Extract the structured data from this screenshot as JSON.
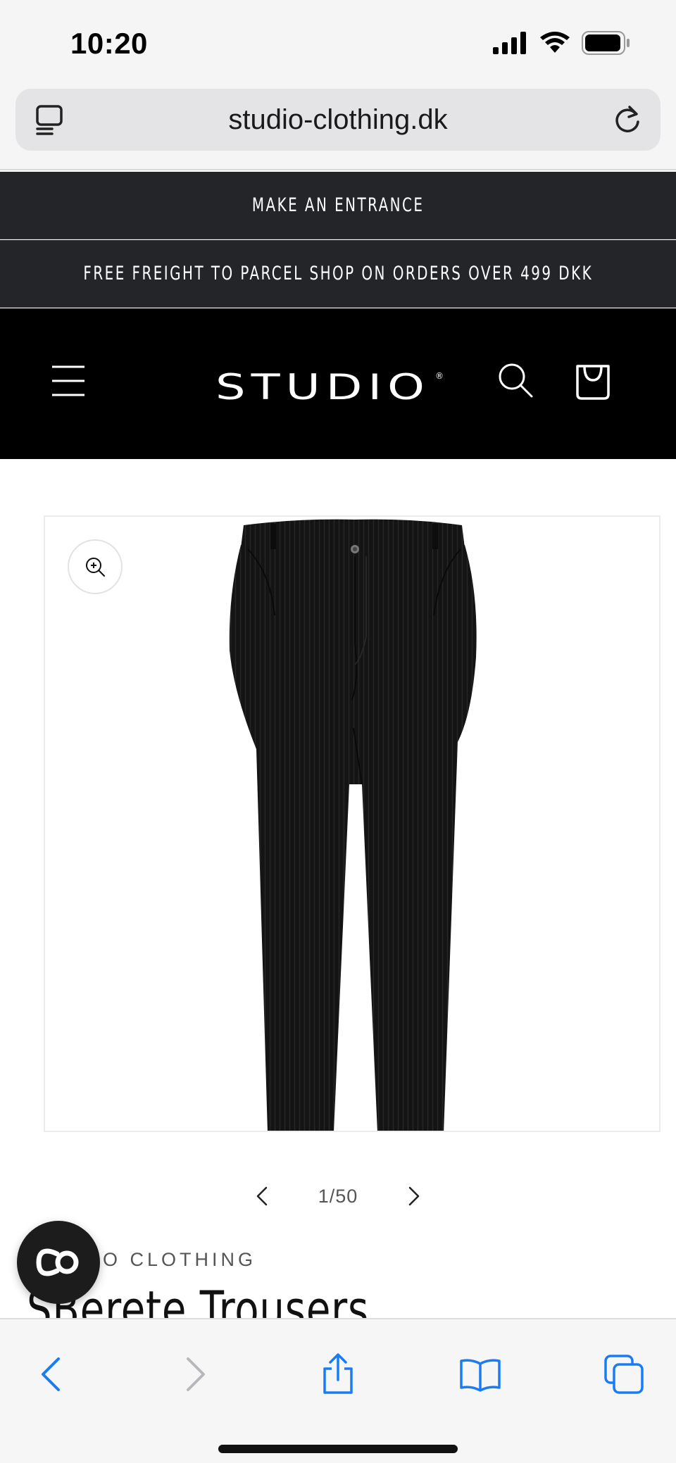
{
  "status_bar": {
    "time": "10:20",
    "icons": [
      "cellular-signal-icon",
      "wifi-icon",
      "battery-icon"
    ]
  },
  "browser": {
    "url": "studio-clothing.dk",
    "icons": [
      "tab-overview-icon",
      "reload-icon"
    ]
  },
  "announcements": [
    "MAKE AN ENTRANCE",
    "FREE FREIGHT TO PARCEL SHOP ON ORDERS OVER 499 DKK"
  ],
  "header": {
    "logo_text": "STUDIO",
    "logo_mark": "®",
    "icons": [
      "menu-icon",
      "search-icon",
      "cart-icon"
    ]
  },
  "gallery": {
    "zoom_icon": "zoom-in-icon",
    "current": 1,
    "total": 50,
    "counter_text": "1/50",
    "image_subject": "black corduroy trousers"
  },
  "product": {
    "vendor": "STUDIO CLOTHING",
    "vendor_visible": "O CLOTHING",
    "title": "SBerete Trousers"
  },
  "toolbar": {
    "icons": [
      "back-icon",
      "forward-icon",
      "share-icon",
      "bookmarks-icon",
      "tabs-icon"
    ]
  },
  "colors": {
    "announcement_bg": "#232529",
    "header_bg": "#000000",
    "browser_accent": "#1a7cf5",
    "chrome_bg": "#f5f5f5"
  }
}
